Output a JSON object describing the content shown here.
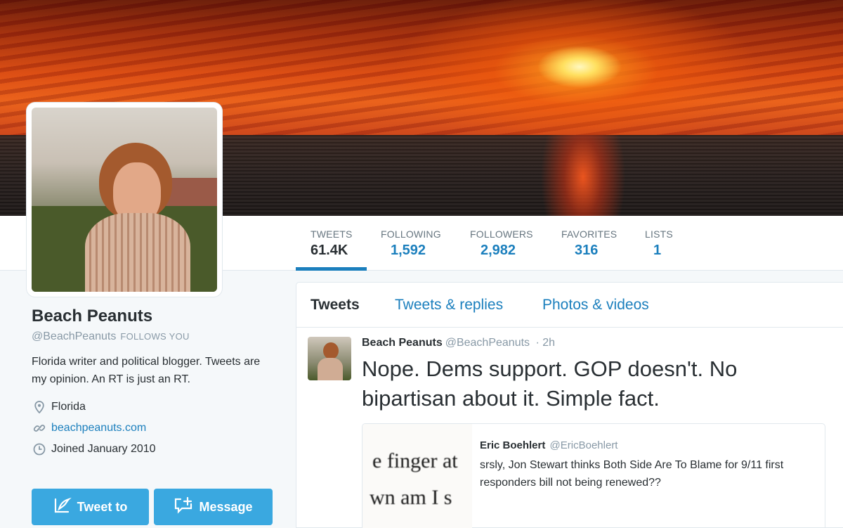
{
  "profile": {
    "name": "Beach Peanuts",
    "handle": "@BeachPeanuts",
    "follows_you": "FOLLOWS YOU",
    "bio": "Florida writer and political blogger. Tweets are my opinion. An RT is just an RT.",
    "location": "Florida",
    "website": "beachpeanuts.com",
    "joined": "Joined January 2010"
  },
  "stats": [
    {
      "label": "TWEETS",
      "value": "61.4K"
    },
    {
      "label": "FOLLOWING",
      "value": "1,592"
    },
    {
      "label": "FOLLOWERS",
      "value": "2,982"
    },
    {
      "label": "FAVORITES",
      "value": "316"
    },
    {
      "label": "LISTS",
      "value": "1"
    }
  ],
  "buttons": {
    "tweet_to": "Tweet to",
    "message": "Message"
  },
  "tabs": [
    {
      "label": "Tweets"
    },
    {
      "label": "Tweets & replies"
    },
    {
      "label": "Photos & videos"
    }
  ],
  "tweet": {
    "name": "Beach Peanuts",
    "handle": "@BeachPeanuts",
    "time": "· 2h",
    "text": "Nope. Dems support. GOP doesn't. No bipartisan about it. Simple fact."
  },
  "quoted": {
    "name": "Eric Boehlert",
    "handle": "@EricBoehlert",
    "text": "srsly, Jon Stewart thinks Both Side Are To Blame for 9/11 first responders bill not being renewed??",
    "image_line1": "e finger at",
    "image_line2": "wn am I s"
  },
  "icons": {
    "location": "map-pin-icon",
    "link": "link-icon",
    "joined": "clock-icon",
    "tweet": "compose-icon",
    "message": "message-plus-icon"
  },
  "colors": {
    "accent": "#1b7fbd",
    "button": "#3aa8e0"
  }
}
